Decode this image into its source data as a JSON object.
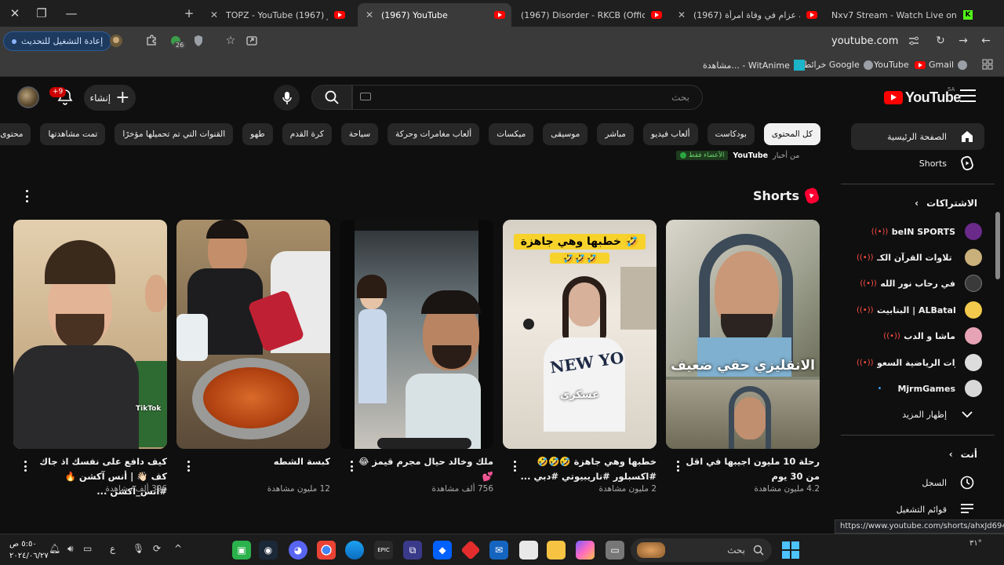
{
  "window_controls": {
    "close": "✕",
    "restore": "❐",
    "minimize": "—",
    "new_tab": "+"
  },
  "tabs": [
    {
      "title": "TOPZ - YouTube تويز (1967)",
      "close": "✕",
      "favicon": "youtube"
    },
    {
      "title": "(1967) YouTube",
      "close": "✕",
      "favicon": "youtube",
      "active": true
    },
    {
      "title": "(1967) Disorder - RKCB (Official",
      "close": "✕",
      "favicon": "youtube"
    },
    {
      "title": "(1967) يشتبه عزام في وفاة امرأة",
      "close": "✕",
      "favicon": "youtube"
    },
    {
      "title": "Nxv7 Stream - Watch Live on Ki",
      "close": "✕",
      "favicon": "kick"
    }
  ],
  "toolbar": {
    "relaunch_label": "إعادة التشغيل للتحديث",
    "extension_badge": "26",
    "url": "youtube.com"
  },
  "bookmarks": [
    {
      "label": "Gmail"
    },
    {
      "label": "YouTube"
    },
    {
      "label": "خرائط Google"
    },
    {
      "label": "مشاهدة... - WitAnime"
    }
  ],
  "masthead": {
    "logo_text": "YouTube",
    "country_code": "SA",
    "search_placeholder": "بحث",
    "create_label": "إنشاء",
    "notification_count": "+9"
  },
  "chips": [
    "كل المحتوى",
    "بودكاست",
    "ألعاب فيديو",
    "مباشر",
    "موسيقى",
    "ميكسات",
    "ألعاب مغامرات وحركة",
    "سياحة",
    "كرة القدم",
    "طهو",
    "القنوات التي تم تحميلها مؤخرًا",
    "تمت مشاهدتها",
    "محتوى جديد لك"
  ],
  "news_row": {
    "prefix": "من أخبار",
    "brand": "YouTube",
    "tag": "الأعضاء فقط"
  },
  "shorts_section": {
    "title": "Shorts",
    "items": [
      {
        "title": "رحلة 10 مليون اجيبها في اقل من 30 يوم",
        "views": "4.2 مليون مشاهدة",
        "overlay": "الانقليزي حقي ضعيف"
      },
      {
        "title": "خطبها وهي جاهزة 🤣🤣🤣 #اكسبلور #ناريبيوتي #دبي ...",
        "views": "2 مليون مشاهدة",
        "overlay": "خطبها وهي جاهزة 🤣",
        "overlay2": "🤣🤣🤣",
        "overlay3": "عسكري"
      },
      {
        "title": "ملك وخالد حيال مجرم قيمز 😂💕",
        "views": "756 ألف مشاهدة"
      },
      {
        "title": "كبسة الشطه",
        "views": "12 مليون مشاهدة"
      },
      {
        "title": "كيف دافع على نفسك اذ جاك كف 👋🏻 | أنس آكشن 🔥 #أنس_آكشن ...",
        "views": "396 ألف مشاهدة",
        "watermark": "TikTok"
      }
    ]
  },
  "sidebar": {
    "home": "الصفحة الرئيسية",
    "shorts": "Shorts",
    "subscriptions_title": "الاشتراكات",
    "subscriptions": [
      {
        "name": "beIN SPORTS",
        "live": true,
        "color": "#6a2a8a"
      },
      {
        "name": "أجمل تلاوات القرآن الكـ...",
        "live": true,
        "color": "#c9b07a"
      },
      {
        "name": "في رحاب نور الله",
        "live": true,
        "color": "#3a3a3a"
      },
      {
        "name": "البتابيت | ALBatabet",
        "live": true,
        "color": "#f2c94c"
      },
      {
        "name": "ماشا و الدب",
        "live": true,
        "color": "#e6a3b5"
      },
      {
        "name": "القنوات الرياضية السعو...",
        "live": true,
        "color": "#dddddd"
      },
      {
        "name": "MjrmGames",
        "live": false,
        "color": "#d8d8d8"
      }
    ],
    "show_more": "إظهار المزيد",
    "you_title": "أنت",
    "history": "السجل",
    "playlists": "قوائم التشغيل"
  },
  "status_url": "https://www.youtube.com/shorts/ahxJd6940k8",
  "taskbar": {
    "search_label": "بحث",
    "clock_time": "٥:٥٠ ص",
    "clock_date": "٢٠٢٤/٠٦/٢٧",
    "lang": "ع",
    "temp": "٣١°"
  }
}
